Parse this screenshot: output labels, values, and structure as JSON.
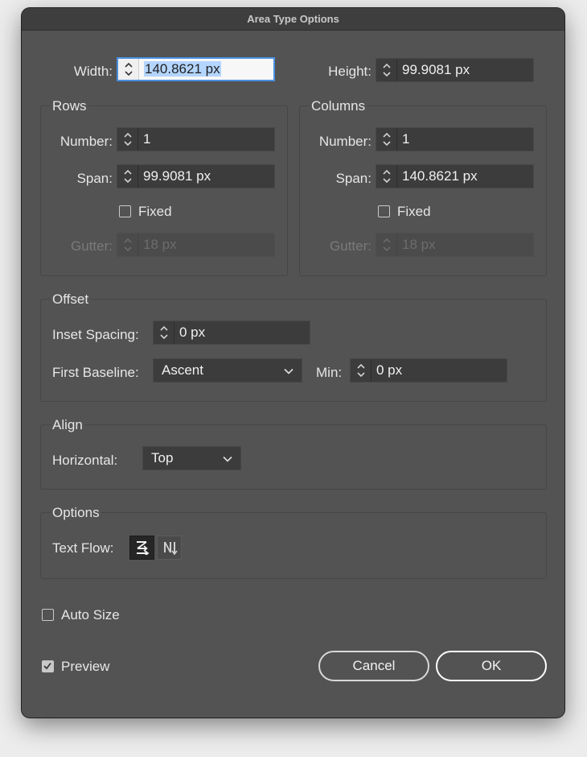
{
  "dialog": {
    "title": "Area Type Options"
  },
  "size": {
    "width_label": "Width:",
    "width_value": "140.8621 px",
    "height_label": "Height:",
    "height_value": "99.9081 px"
  },
  "rows": {
    "title": "Rows",
    "number_label": "Number:",
    "number_value": "1",
    "span_label": "Span:",
    "span_value": "99.9081 px",
    "fixed_label": "Fixed",
    "fixed_checked": false,
    "gutter_label": "Gutter:",
    "gutter_value": "18 px"
  },
  "columns": {
    "title": "Columns",
    "number_label": "Number:",
    "number_value": "1",
    "span_label": "Span:",
    "span_value": "140.8621 px",
    "fixed_label": "Fixed",
    "fixed_checked": false,
    "gutter_label": "Gutter:",
    "gutter_value": "18 px"
  },
  "offset": {
    "title": "Offset",
    "inset_label": "Inset Spacing:",
    "inset_value": "0 px",
    "baseline_label": "First Baseline:",
    "baseline_value": "Ascent",
    "min_label": "Min:",
    "min_value": "0 px"
  },
  "align": {
    "title": "Align",
    "horizontal_label": "Horizontal:",
    "horizontal_value": "Top"
  },
  "options": {
    "title": "Options",
    "textflow_label": "Text Flow:",
    "textflow_icons": [
      "text-flow-by-rows-icon",
      "text-flow-by-columns-icon"
    ]
  },
  "auto_size": {
    "label": "Auto Size",
    "checked": false
  },
  "preview": {
    "label": "Preview",
    "checked": true
  },
  "buttons": {
    "cancel": "Cancel",
    "ok": "OK"
  },
  "colors": {
    "focus": "#4a90e2",
    "selection": "#b4d5fe",
    "dialog_bg": "#535353"
  }
}
